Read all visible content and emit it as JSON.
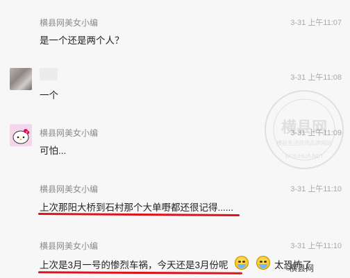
{
  "messages": [
    {
      "name": "横县网美女小编",
      "time": "3-31 上午11:07",
      "text": "是一个还是两个人？"
    },
    {
      "name": "",
      "time": "3-31 上午11:08",
      "text": "一个"
    },
    {
      "name": "横县网美女小编",
      "time": "3-31 上午11:09",
      "text": "可怕..."
    },
    {
      "name": "横县网美女小编",
      "time": "3-31 上午11:10",
      "text": "上次那阳大桥到石村那个大单嘢都还很记得......"
    },
    {
      "name": "横县网美女小编",
      "time": "3-31 上午11:10",
      "text": "上次是3月一号的惨烈车祸，今天还是3月份呢",
      "suffix": "太恐怖了"
    }
  ],
  "watermark": {
    "title": "横县网",
    "subtitle": "横县生活资讯品牌网站",
    "url": "WOLIHUA.NET",
    "bottom_label": "横县网"
  },
  "colors": {
    "underline": "#d9141c",
    "name": "#8a8a8a",
    "time": "#a8a8a8",
    "text": "#222222"
  }
}
